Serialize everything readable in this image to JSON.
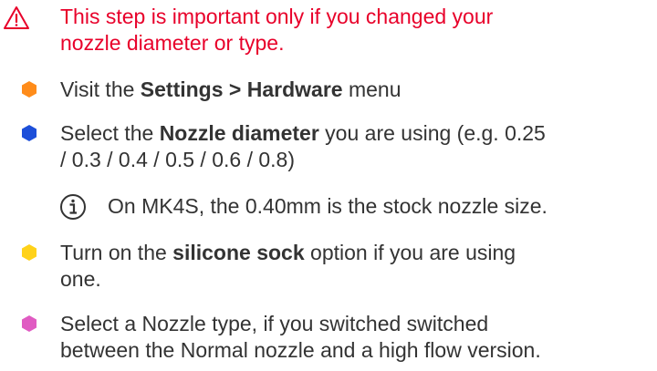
{
  "warning": {
    "line1": "This step is important only if you changed your",
    "line2": "nozzle diameter or type."
  },
  "steps": [
    {
      "color": "#ff8c1a",
      "parts": [
        "Visit the ",
        "Settings > Hardware",
        " menu"
      ]
    },
    {
      "color": "#1d4fd9",
      "line1": [
        "Select the ",
        "Nozzle diameter",
        " you are using (e.g. 0.25"
      ],
      "line2": "/ 0.3 / 0.4 / 0.5 / 0.6 / 0.8)"
    },
    {
      "note": "On MK4S, the 0.40mm is the stock nozzle size."
    },
    {
      "color": "#ffd21a",
      "line1": [
        "Turn on the ",
        "silicone sock",
        " option if you are using"
      ],
      "line2": "one."
    },
    {
      "color": "#e05bc2",
      "line1": "Select a Nozzle type, if you switched switched",
      "line2": "between the Normal nozzle and a high flow version."
    }
  ]
}
